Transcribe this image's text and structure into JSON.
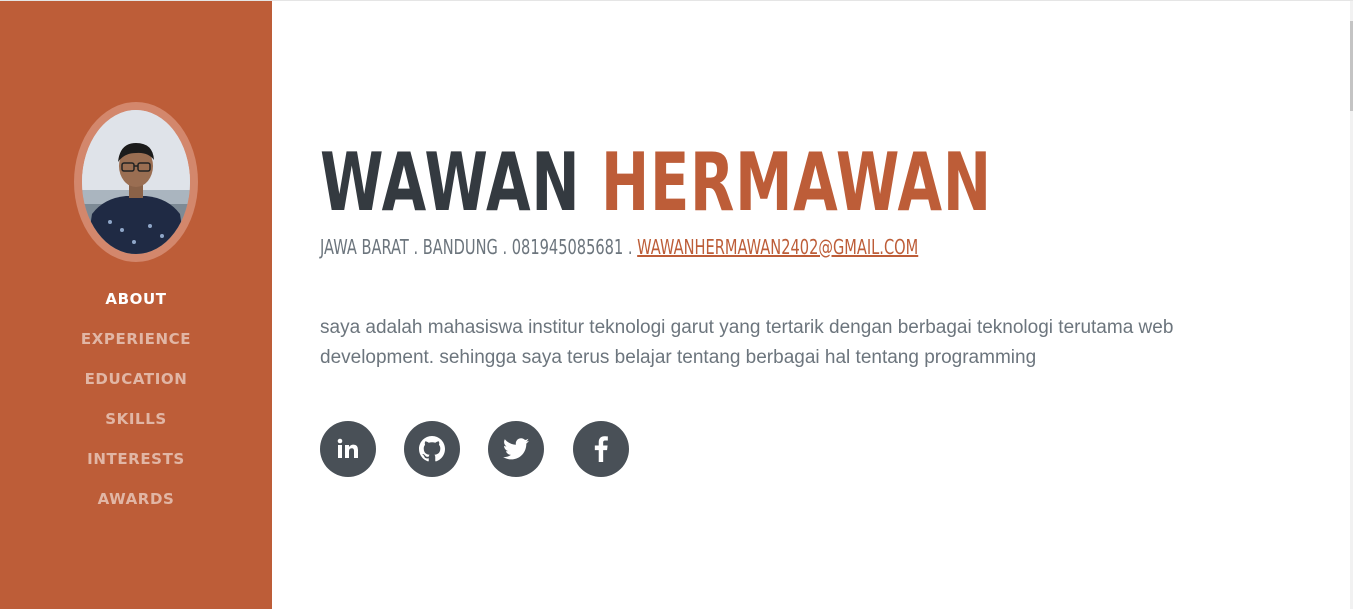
{
  "profile": {
    "first_name": "WAWAN",
    "last_name": "HERMAWAN",
    "location": "JAWA BARAT . BANDUNG . 081945085681 . ",
    "email": "WAWANHERMAWAN2402@GMAIL.COM",
    "about": "saya adalah mahasiswa institur teknologi garut yang tertarik dengan berbagai teknologi terutama web development. sehingga saya terus belajar tentang berbagai hal tentang programming"
  },
  "nav": {
    "items": [
      {
        "label": "ABOUT",
        "active": true
      },
      {
        "label": "EXPERIENCE",
        "active": false
      },
      {
        "label": "EDUCATION",
        "active": false
      },
      {
        "label": "SKILLS",
        "active": false
      },
      {
        "label": "INTERESTS",
        "active": false
      },
      {
        "label": "AWARDS",
        "active": false
      }
    ]
  },
  "social": {
    "icons": [
      "linkedin-icon",
      "github-icon",
      "twitter-icon",
      "facebook-icon"
    ]
  },
  "colors": {
    "primary": "#bd5d38",
    "dark": "#343a40",
    "muted": "#6c757d",
    "social_bg": "#495057"
  }
}
